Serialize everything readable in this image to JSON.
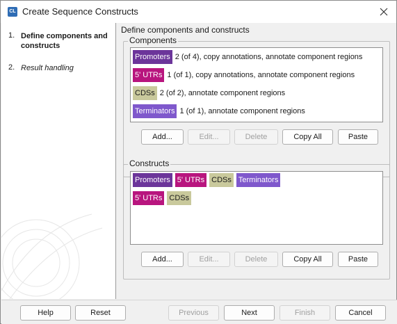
{
  "window": {
    "title": "Create Sequence Constructs",
    "icon_label": "CL"
  },
  "steps": [
    {
      "num": "1.",
      "label": "Define components and constructs"
    },
    {
      "num": "2.",
      "label": "Result handling"
    }
  ],
  "content": {
    "heading": "Define components and constructs"
  },
  "components": {
    "title": "Components",
    "rows": [
      {
        "tag": "Promoters",
        "desc": "2 (of 4), copy annotations, annotate component regions",
        "color": "#6c359a"
      },
      {
        "tag": "5' UTRs",
        "desc": "1 (of 1), copy annotations, annotate component regions",
        "color": "#b8157e"
      },
      {
        "tag": "CDSs",
        "desc": "2 (of 2), annotate component regions",
        "color": "#c9c99c"
      },
      {
        "tag": "Terminators",
        "desc": "1 (of 1), annotate component regions",
        "color": "#7f58cc"
      }
    ],
    "buttons": {
      "add": "Add...",
      "edit": "Edit...",
      "delete": "Delete",
      "copy_all": "Copy All",
      "paste": "Paste"
    }
  },
  "constructs": {
    "title": "Constructs",
    "rows": [
      [
        "Promoters",
        "5' UTRs",
        "CDSs",
        "Terminators"
      ],
      [
        "5' UTRs",
        "CDSs"
      ]
    ],
    "buttons": {
      "add": "Add...",
      "edit": "Edit...",
      "delete": "Delete",
      "copy_all": "Copy All",
      "paste": "Paste"
    }
  },
  "footer": {
    "help": "Help",
    "reset": "Reset",
    "previous": "Previous",
    "next": "Next",
    "finish": "Finish",
    "cancel": "Cancel"
  },
  "icons": [
    "close-icon",
    "app-icon",
    "watermark-graphic"
  ]
}
